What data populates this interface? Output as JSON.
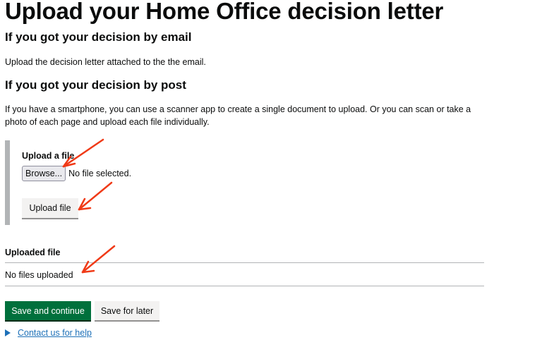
{
  "page": {
    "title": "Upload your Home Office decision letter",
    "email_heading": "If you got your decision by email",
    "email_text": "Upload the decision letter attached to the the email.",
    "post_heading": "If you got your decision by post",
    "post_text": "If you have a smartphone, you can use a scanner app to create a single document to upload. Or you can scan or take a photo of each page and upload each file individually."
  },
  "upload_panel": {
    "label": "Upload a file",
    "browse_label": "Browse...",
    "file_status": "No file selected.",
    "upload_button": "Upload file"
  },
  "uploaded": {
    "heading": "Uploaded file",
    "empty_text": "No files uploaded"
  },
  "actions": {
    "save_continue": "Save and continue",
    "save_later": "Save for later"
  },
  "help": {
    "link_text": "Contact us for help"
  },
  "colors": {
    "primary_button": "#00703c",
    "link": "#1d70b8",
    "annotation_arrow": "#f03a17"
  }
}
